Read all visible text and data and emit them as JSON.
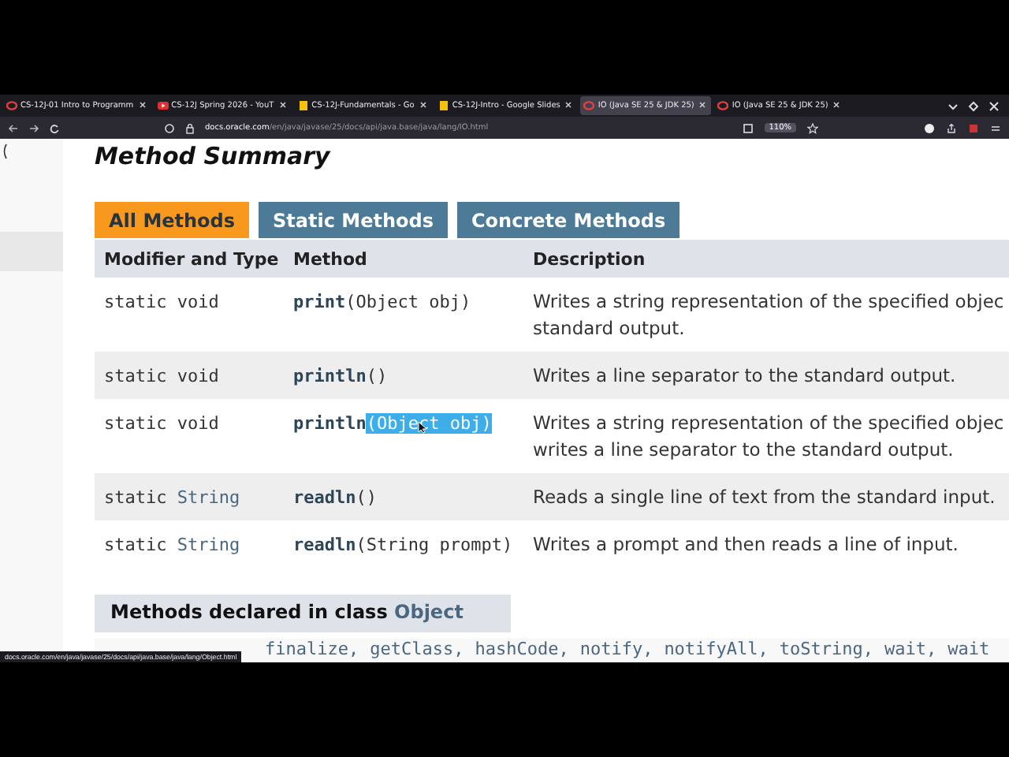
{
  "browser": {
    "tabs": [
      {
        "title": "CS-12J-01 Intro to Programm",
        "kind": "ring",
        "selected": false
      },
      {
        "title": "CS-12J Spring 2026 - YouT",
        "kind": "video",
        "selected": false
      },
      {
        "title": "CS-12J-Fundamentals - Go",
        "kind": "doc",
        "selected": false
      },
      {
        "title": "CS-12J-Intro - Google Slides",
        "kind": "doc",
        "selected": false
      },
      {
        "title": "IO (Java SE 25 & JDK 25)",
        "kind": "ring",
        "selected": true
      },
      {
        "title": "IO (Java SE 25 & JDK 25)",
        "kind": "ring",
        "selected": false
      }
    ],
    "url_host": "docs.oracle.com",
    "url_path": "/en/java/javase/25/docs/api/java.base/java/lang/IO.html",
    "zoom": "110%"
  },
  "section_title": "Method Summary",
  "filters": [
    {
      "label": "All Methods",
      "selected": true
    },
    {
      "label": "Static Methods",
      "selected": false
    },
    {
      "label": "Concrete Methods",
      "selected": false
    }
  ],
  "table": {
    "columns": [
      "Modifier and Type",
      "Method",
      "Description"
    ],
    "rows": [
      {
        "modifier": "static",
        "type": "void",
        "type_link": false,
        "method": "print",
        "args": "(Object obj)",
        "args_selected": false,
        "description": [
          "Writes a string representation of the specified objec",
          "standard output."
        ]
      },
      {
        "modifier": "static",
        "type": "void",
        "type_link": false,
        "method": "println",
        "args": "()",
        "args_selected": false,
        "description": [
          "Writes a line separator to the standard output."
        ]
      },
      {
        "modifier": "static",
        "type": "void",
        "type_link": false,
        "method": "println",
        "args": "(Object obj)",
        "args_selected": true,
        "description": [
          "Writes a string representation of the specified objec",
          "writes a line separator to the standard output."
        ]
      },
      {
        "modifier": "static",
        "type": "String",
        "type_link": true,
        "method": "readln",
        "args": "()",
        "args_selected": false,
        "description": [
          "Reads a single line of text from the standard input."
        ]
      },
      {
        "modifier": "static",
        "type": "String",
        "type_link": true,
        "method": "readln",
        "args": "(String prompt)",
        "args_selected": false,
        "description": [
          "Writes a prompt and then reads a line of input."
        ]
      }
    ]
  },
  "inherited": {
    "heading": "Methods declared in class",
    "class_link": "Object",
    "methods": [
      "finalize,",
      "getClass,",
      "hashCode,",
      "notify,",
      "notifyAll,",
      "toString,",
      "wait,",
      "wait"
    ]
  },
  "status_link": "docs.oracle.com/en/java/javase/25/docs/api/java.base/java/lang/Object.html"
}
